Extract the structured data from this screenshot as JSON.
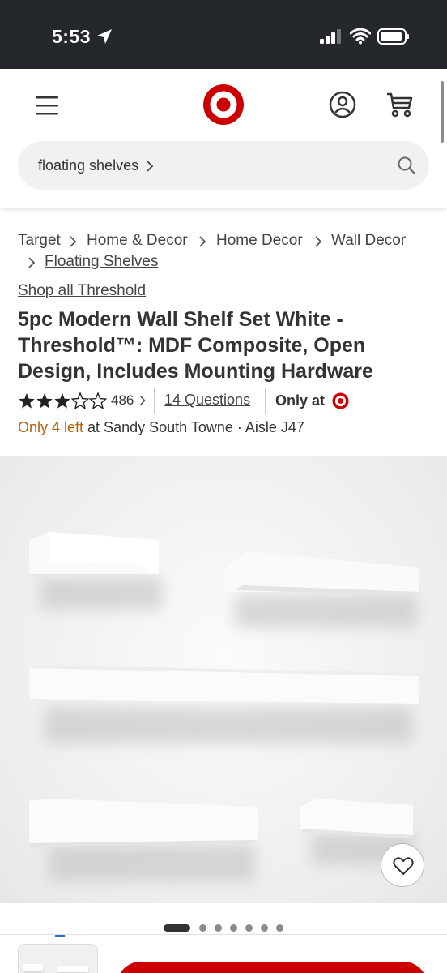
{
  "status_bar": {
    "time": "5:53",
    "icons": [
      "location-arrow-icon",
      "cellular-signal-icon",
      "wifi-icon",
      "battery-icon"
    ]
  },
  "header": {
    "icons": [
      "menu-icon",
      "target-logo",
      "account-icon",
      "cart-icon"
    ],
    "brand_color": "#cc0000"
  },
  "search": {
    "value": "floating shelves",
    "icon": "search-icon"
  },
  "breadcrumbs": [
    "Target",
    "Home & Decor",
    "Home Decor",
    "Wall Decor",
    "Floating Shelves"
  ],
  "shop_all": "Shop all Threshold",
  "product": {
    "title": "5pc Modern Wall Shelf Set White - Threshold™: MDF Composite, Open Design, Includes Mounting Hardware",
    "rating": 3.5,
    "rating_max": 5,
    "rating_count": "486",
    "questions": "14 Questions",
    "only_at": "Only at",
    "stock_warning": "Only 4 left",
    "stock_location": " at Sandy South Towne · Aisle J47",
    "warning_color": "#b85e00"
  },
  "gallery": {
    "image_count": 7,
    "active_index": 0,
    "favorite_icon": "heart-icon"
  }
}
